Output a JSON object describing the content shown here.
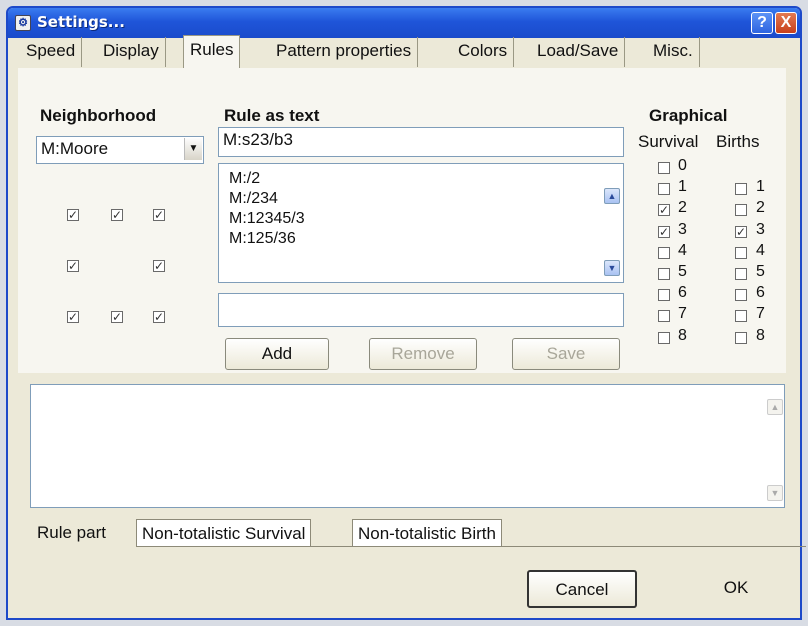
{
  "window": {
    "title": "Settings...",
    "app_icon": "settings-app-icon",
    "help_label": "?",
    "close_label": "X"
  },
  "tabs": [
    {
      "label": "Speed"
    },
    {
      "label": "Display"
    },
    {
      "label": "Rules",
      "active": true
    },
    {
      "label": "Pattern properties"
    },
    {
      "label": "Colors"
    },
    {
      "label": "Load/Save"
    },
    {
      "label": "Misc."
    }
  ],
  "neighborhood": {
    "title": "Neighborhood",
    "selected": "M:Moore",
    "grid_checked": [
      true,
      true,
      true,
      true,
      null,
      true,
      true,
      true,
      true
    ]
  },
  "rule_text": {
    "title": "Rule as text",
    "value": "M:s23/b3",
    "list": [
      "M:/2",
      "M:/234",
      "M:12345/3",
      "M:125/36"
    ],
    "new_rule": "",
    "add_label": "Add",
    "remove_label": "Remove",
    "save_label": "Save"
  },
  "graphical": {
    "title": "Graphical",
    "survival_label": "Survival",
    "births_label": "Births",
    "survival": [
      {
        "n": "0",
        "checked": false
      },
      {
        "n": "1",
        "checked": false
      },
      {
        "n": "2",
        "checked": true
      },
      {
        "n": "3",
        "checked": true
      },
      {
        "n": "4",
        "checked": false
      },
      {
        "n": "5",
        "checked": false
      },
      {
        "n": "6",
        "checked": false
      },
      {
        "n": "7",
        "checked": false
      },
      {
        "n": "8",
        "checked": false
      }
    ],
    "births": [
      {
        "n": "1",
        "checked": false
      },
      {
        "n": "2",
        "checked": false
      },
      {
        "n": "3",
        "checked": true
      },
      {
        "n": "4",
        "checked": false
      },
      {
        "n": "5",
        "checked": false
      },
      {
        "n": "6",
        "checked": false
      },
      {
        "n": "7",
        "checked": false
      },
      {
        "n": "8",
        "checked": false
      }
    ]
  },
  "description": {
    "text": ""
  },
  "bottom_tabs": [
    {
      "label": "Rule part",
      "active": true
    },
    {
      "label": "Non-totalistic Survival"
    },
    {
      "label": "Non-totalistic Birth"
    }
  ],
  "footer": {
    "cancel_label": "Cancel",
    "ok_label": "OK"
  }
}
